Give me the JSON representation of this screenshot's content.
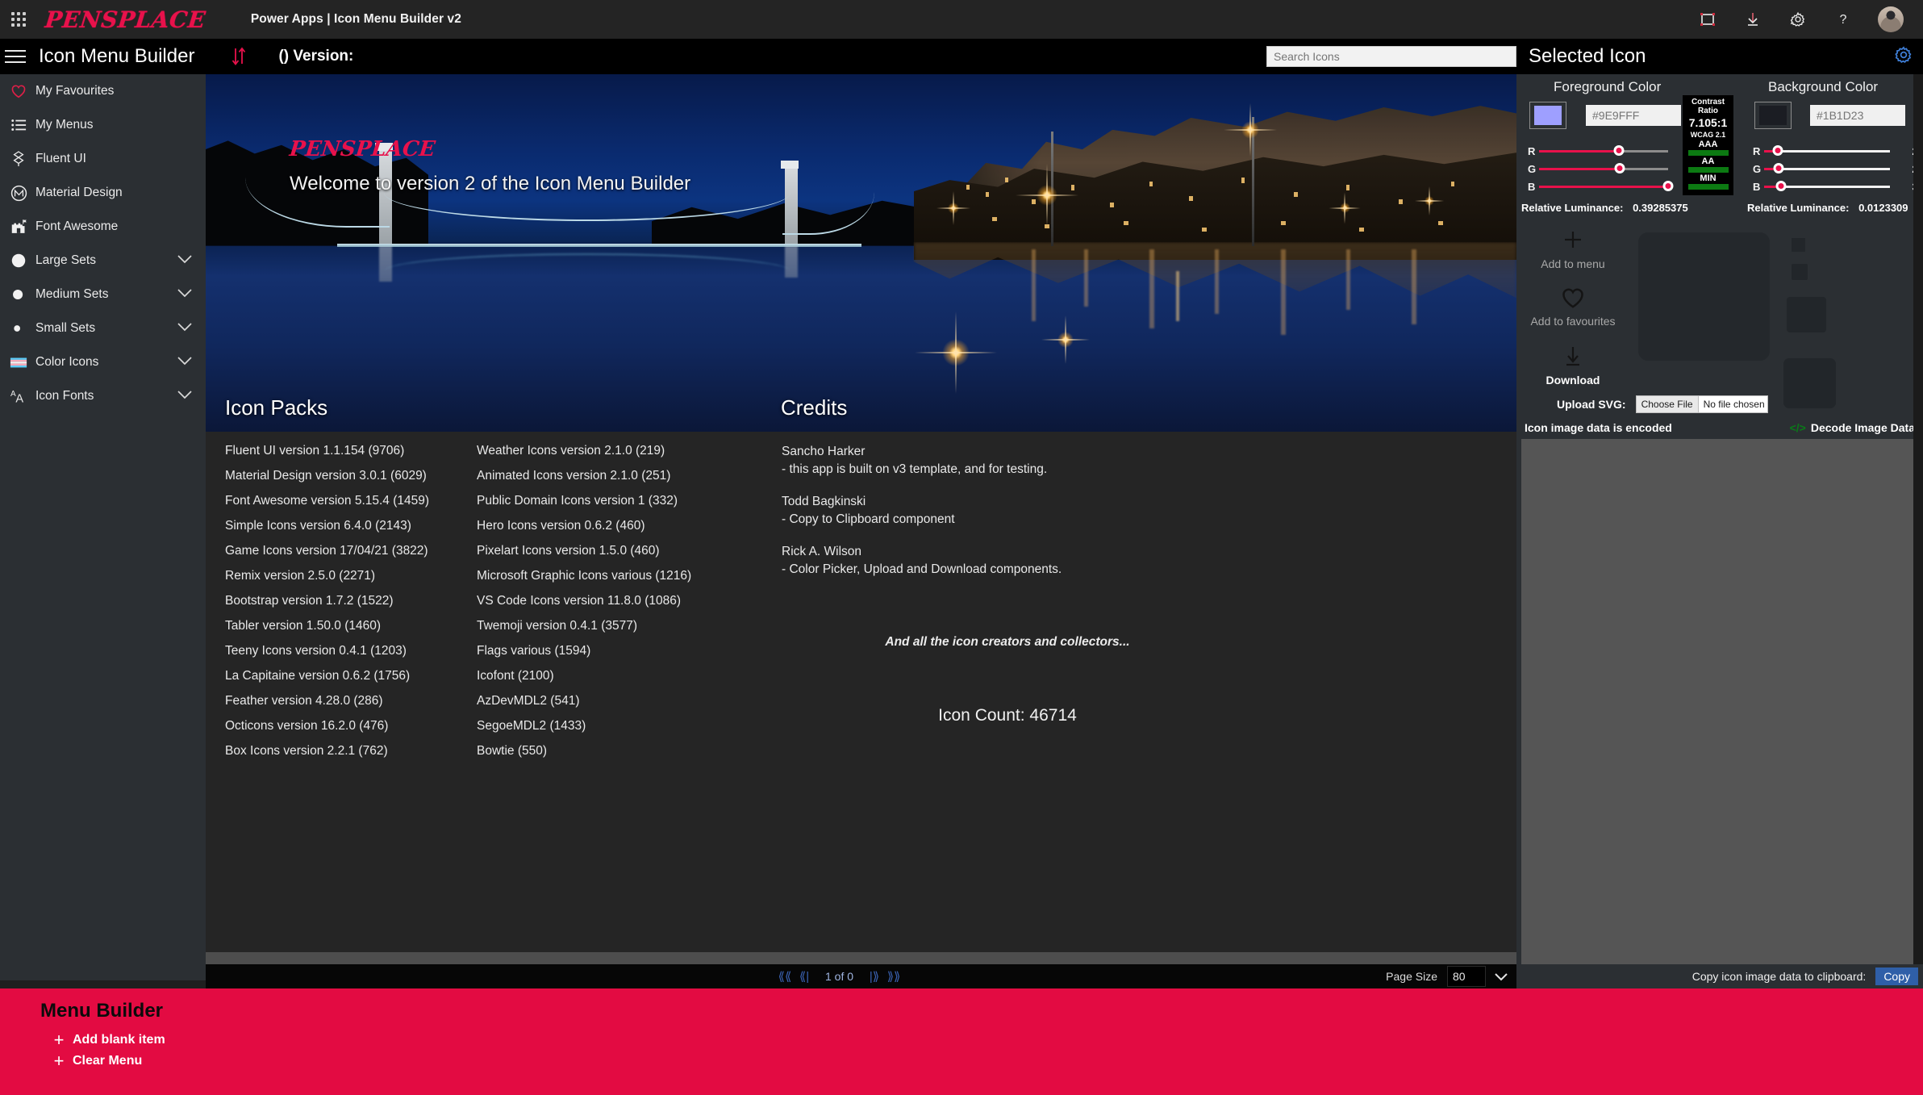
{
  "suite": {
    "brand": "PENSPLACE",
    "app_title": "Power Apps  |  Icon Menu Builder v2",
    "icons": [
      {
        "name": "fit-to-screen-icon",
        "glyph": "⏹"
      },
      {
        "name": "download-icon",
        "glyph": "↓"
      },
      {
        "name": "settings-gear-icon",
        "glyph": "⚙"
      },
      {
        "name": "help-icon",
        "glyph": "?"
      }
    ],
    "avatar_name": "user-avatar"
  },
  "header": {
    "title": "Icon Menu Builder",
    "sort_icon": "sort-updown-icon",
    "version_text": "() Version:",
    "search_placeholder": "Search Icons",
    "search_value": "",
    "selected_panel_title": "Selected Icon",
    "panel_gear": "panel-settings-gear-icon"
  },
  "sidebar": {
    "items": [
      {
        "label": "My Favourites",
        "icon": "heart-icon",
        "chevron": false
      },
      {
        "label": "My Menus",
        "icon": "list-icon",
        "chevron": false
      },
      {
        "label": "Fluent UI",
        "icon": "fluent-ui-icon",
        "chevron": false
      },
      {
        "label": "Material Design",
        "icon": "material-design-icon",
        "chevron": false
      },
      {
        "label": "Font Awesome",
        "icon": "font-awesome-flag-icon",
        "chevron": false
      },
      {
        "label": "Large Sets",
        "icon": "large-circle-icon",
        "chevron": true
      },
      {
        "label": "Medium Sets",
        "icon": "medium-circle-icon",
        "chevron": true
      },
      {
        "label": "Small Sets",
        "icon": "small-circle-icon",
        "chevron": true
      },
      {
        "label": "Color Icons",
        "icon": "color-flag-icon",
        "chevron": true
      },
      {
        "label": "Icon Fonts",
        "icon": "font-aa-icon",
        "chevron": true
      }
    ]
  },
  "hero": {
    "logo": "PENSPLACE",
    "welcome": "Welcome to version 2 of the Icon Menu Builder",
    "heading_packs": "Icon Packs",
    "heading_credits": "Credits"
  },
  "icon_packs": {
    "column1": [
      "Fluent UI version 1.1.154 (9706)",
      "Material Design version 3.0.1 (6029)",
      "Font Awesome version 5.15.4 (1459)",
      "Simple Icons version 6.4.0 (2143)",
      "Game Icons version 17/04/21 (3822)",
      "Remix version 2.5.0 (2271)",
      "Bootstrap version 1.7.2 (1522)",
      "Tabler version 1.50.0 (1460)",
      "Teeny Icons version 0.4.1 (1203)",
      "La Capitaine version 0.6.2 (1756)",
      "Feather version 4.28.0 (286)",
      "Octicons version 16.2.0 (476)",
      "Box Icons version 2.2.1 (762)"
    ],
    "column2": [
      "Weather Icons version 2.1.0 (219)",
      "Animated Icons version 2.1.0 (251)",
      "Public Domain Icons version 1 (332)",
      "Hero Icons version 0.6.2 (460)",
      "Pixelart Icons version 1.5.0 (460)",
      "Microsoft Graphic Icons various (1216)",
      "VS Code Icons version 11.8.0 (1086)",
      "Twemoji version 0.4.1 (3577)",
      "Flags various (1594)",
      "Icofont (2100)",
      "AzDevMDL2 (541)",
      "SegoeMDL2 (1433)",
      "Bowtie (550)"
    ]
  },
  "credits": {
    "entries": [
      {
        "name": "Sancho Harker",
        "desc": "- this app is built on v3 template, and for testing."
      },
      {
        "name": "Todd Bagkinski",
        "desc": "- Copy to Clipboard component"
      },
      {
        "name": "Rick A. Wilson",
        "desc": "- Color Picker, Upload and Download components."
      }
    ],
    "footer": "And all the icon creators and collectors...",
    "icon_count": "Icon Count: 46714"
  },
  "pager": {
    "first_icon": "first-page-icon",
    "prev_icon": "previous-page-icon",
    "label": "1 of 0",
    "next_icon": "next-page-icon",
    "last_icon": "last-page-icon",
    "page_size_label": "Page Size",
    "page_size_value": "80",
    "page_size_chevron": "chevron-down-icon"
  },
  "selected_icon": {
    "foreground": {
      "title": "Foreground Color",
      "swatch_hex": "#9E9FFF",
      "hex_placeholder": "#9E9FFF",
      "hex_value": "",
      "sliders": [
        {
          "label": "R",
          "value": 158,
          "max": 255
        },
        {
          "label": "G",
          "value": 159,
          "max": 255
        },
        {
          "label": "B",
          "value": 255,
          "max": 255
        }
      ],
      "luminance_label": "Relative Luminance:",
      "luminance_value": "0.39285375"
    },
    "background": {
      "title": "Background Color",
      "swatch_hex": "#1B1D23",
      "hex_placeholder": "#1B1D23",
      "hex_value": "",
      "sliders": [
        {
          "label": "R",
          "value": 27,
          "max": 255
        },
        {
          "label": "G",
          "value": 29,
          "max": 255
        },
        {
          "label": "B",
          "value": 35,
          "max": 255
        }
      ],
      "luminance_label": "Relative Luminance:",
      "luminance_value": "0.0123309"
    },
    "contrast": {
      "title_line1": "Contrast",
      "title_line2": "Ratio",
      "ratio": "7.105:1",
      "standard": "WCAG 2.1",
      "levels": [
        {
          "label": "AAA",
          "pass": true
        },
        {
          "label": "AA",
          "pass": true
        },
        {
          "label": "MIN",
          "pass": true
        }
      ],
      "pass_color": "#0C7A12"
    },
    "actions": [
      {
        "label": "Add to menu",
        "icon": "plus-icon",
        "glyph": "+",
        "strong": false
      },
      {
        "label": "Add to favourites",
        "icon": "heart-outline-icon",
        "glyph": "♡",
        "strong": false
      },
      {
        "label": "Download",
        "icon": "download-arrow-icon",
        "glyph": "↓",
        "strong": true
      }
    ],
    "upload": {
      "label": "Upload SVG:",
      "choose_button": "Choose File",
      "file_status": "No file chosen"
    },
    "encoded_text": "Icon image data is encoded",
    "decode_label": "Decode Image Data",
    "decode_icon": "code-brackets-icon"
  },
  "copy_bar": {
    "label": "Copy icon image data to clipboard:",
    "button": "Copy",
    "button_color": "#2F5FA8"
  },
  "menu_builder": {
    "title": "Menu Builder",
    "items": [
      {
        "label": "Add blank item",
        "icon": "plus-icon"
      },
      {
        "label": "Clear Menu",
        "icon": "plus-icon"
      }
    ],
    "accent_color": "#E30B42"
  }
}
